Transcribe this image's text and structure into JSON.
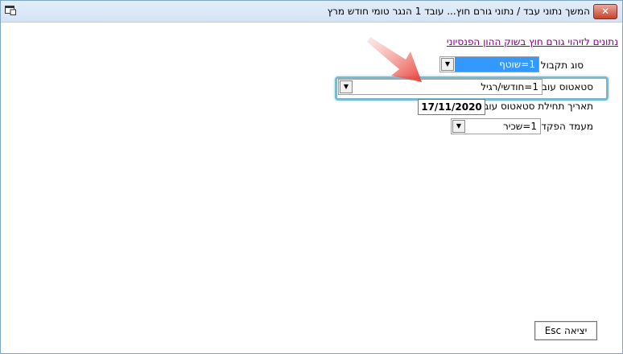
{
  "window": {
    "title": "המשך נתוני עבד / נתוני גורם חוץ...   עובד 1 הנגר טומי   חודש מרץ",
    "close_label": "✕"
  },
  "form": {
    "section_link": "נתונים לזיהוי גורם חוץ בשוק ההון הפנסיוני",
    "receipt_type": {
      "label": "סוג תקבול",
      "value": "1=שוטף"
    },
    "employee_status": {
      "label": "סטאטוס עובד",
      "value": "1=חודשי/רגיל"
    },
    "status_start_date": {
      "label": "תאריך תחילת סטאטוס עובד",
      "value": "17/11/2020"
    },
    "deposit_position": {
      "label": "מעמד הפקדה",
      "value": "1=שכיר"
    }
  },
  "footer": {
    "exit_label": "יציאה Esc"
  },
  "colors": {
    "selection": "#3399ff",
    "link": "#800080",
    "highlight": "#7bb9cf",
    "arrow": "#e8413a"
  },
  "icons": {
    "dropdown": "chevron-down-icon",
    "system": "window-icon",
    "annotation": "red-arrow-icon"
  }
}
